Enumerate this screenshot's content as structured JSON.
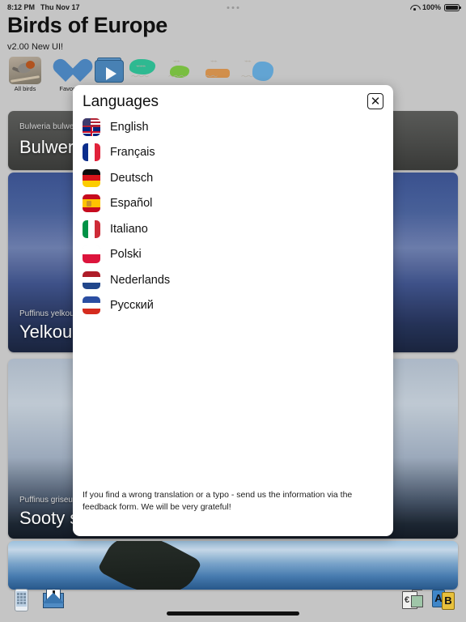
{
  "status_bar": {
    "time": "8:12 PM",
    "date": "Thu Nov 17",
    "battery_percent": "100%",
    "wifi_icon": "wifi-icon",
    "battery_icon": "battery-icon",
    "multitask_handle": "three-dots-icon"
  },
  "header": {
    "title": "Birds of Europe",
    "version": "v2.00 New UI!"
  },
  "toolbar": {
    "items": [
      {
        "label": "All birds",
        "icon": "bird-photo-icon"
      },
      {
        "label": "Favor",
        "icon": "heart-icon"
      },
      {
        "label": "",
        "icon": "video-player-icon"
      },
      {
        "label": "",
        "icon": "map-region-teal-icon"
      },
      {
        "label": "",
        "icon": "map-region-green-icon"
      },
      {
        "label": "",
        "icon": "map-region-orange-icon"
      },
      {
        "label": "",
        "icon": "map-region-blue-icon"
      }
    ]
  },
  "species_cards": [
    {
      "scientific": "Bulweria bulwerii",
      "common": "Bulwer"
    },
    {
      "scientific": "Puffinus yelkouan",
      "common": "Yelkoua"
    },
    {
      "scientific": "Puffinus griseus",
      "common": "Sooty s"
    },
    {
      "scientific": "",
      "common": ""
    }
  ],
  "modal": {
    "title": "Languages",
    "close_label": "✕",
    "close_icon": "close-icon",
    "note": "If you find a wrong translation or a typo - send us the information via the feedback form. We will be very grateful!",
    "languages": [
      {
        "name": "English",
        "flag": "flag-english-icon"
      },
      {
        "name": "Français",
        "flag": "flag-france-icon"
      },
      {
        "name": "Deutsch",
        "flag": "flag-germany-icon"
      },
      {
        "name": "Español",
        "flag": "flag-spain-icon"
      },
      {
        "name": "Italiano",
        "flag": "flag-italy-icon"
      },
      {
        "name": "Polski",
        "flag": "flag-poland-icon"
      },
      {
        "name": "Nederlands",
        "flag": "flag-netherlands-icon"
      },
      {
        "name": "Русский",
        "flag": "flag-russia-icon"
      }
    ]
  },
  "bottom_bar": {
    "left_items": [
      {
        "icon": "apps-phone-icon"
      },
      {
        "icon": "mail-info-icon"
      }
    ],
    "right_items": [
      {
        "icon": "money-euro-icon"
      },
      {
        "icon": "translate-ab-icon",
        "letter_a": "A",
        "letter_b": "B"
      }
    ],
    "home_indicator": "home-indicator"
  },
  "colors": {
    "page_background": "#c9c9c9",
    "accent_blue": "#4c86c0",
    "modal_background": "#ffffff",
    "text_primary": "#111111"
  }
}
